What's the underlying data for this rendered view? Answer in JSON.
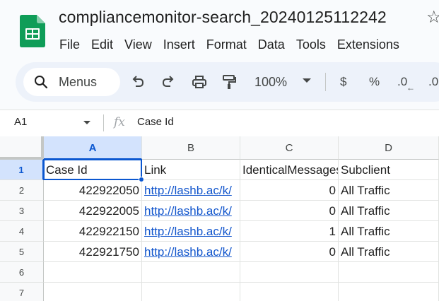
{
  "window": {
    "title": "compliancemonitor-search_20240125112242",
    "star_icon": "star-outline-icon"
  },
  "menu": [
    "File",
    "Edit",
    "View",
    "Insert",
    "Format",
    "Data",
    "Tools",
    "Extensions"
  ],
  "toolbar": {
    "search_label": "Menus",
    "zoom": "100%",
    "currency": "$",
    "percent": "%",
    "decrease_decimal": ".0",
    "increase_decimal": ".0"
  },
  "formula_bar": {
    "cell_ref": "A1",
    "fx_label": "fx",
    "value": "Case Id"
  },
  "sheet": {
    "columns": [
      "A",
      "B",
      "C",
      "D"
    ],
    "selected_column": "A",
    "selected_row": "1",
    "rows": [
      {
        "num": "1",
        "cells": [
          "Case Id",
          "Link",
          "IdenticalMessages",
          "Subclient"
        ]
      },
      {
        "num": "2",
        "cells": [
          "422922050",
          "http://lashb.ac/k/",
          "0",
          "All Traffic"
        ]
      },
      {
        "num": "3",
        "cells": [
          "422922005",
          "http://lashb.ac/k/",
          "0",
          "All Traffic"
        ]
      },
      {
        "num": "4",
        "cells": [
          "422922150",
          "http://lashb.ac/k/",
          "1",
          "All Traffic"
        ]
      },
      {
        "num": "5",
        "cells": [
          "422921750",
          "http://lashb.ac/k/",
          "0",
          "All Traffic"
        ]
      },
      {
        "num": "6",
        "cells": [
          "",
          "",
          "",
          ""
        ]
      },
      {
        "num": "7",
        "cells": [
          "",
          "",
          "",
          ""
        ]
      }
    ]
  },
  "colors": {
    "accent": "#0b57d0",
    "selection_fill": "#d3e3fd",
    "link": "#1155cc",
    "sheets_green": "#0f9d58"
  }
}
